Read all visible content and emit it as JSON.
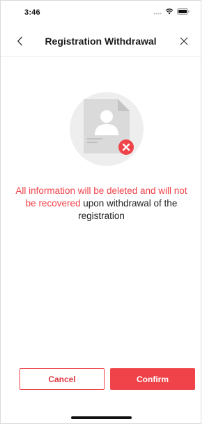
{
  "status_bar": {
    "time": "3:46",
    "icons": [
      "signal-icon",
      "wifi-icon",
      "battery-icon"
    ]
  },
  "nav": {
    "title": "Registration Withdrawal",
    "back_icon": "chevron-left-icon",
    "close_icon": "close-icon"
  },
  "illustration": {
    "icon": "document-user-delete-icon",
    "badge_color": "#ef4249"
  },
  "message": {
    "highlight": "All information will be deleted and will not be recovered",
    "rest": " upon withdrawal of the registration"
  },
  "buttons": {
    "cancel_label": "Cancel",
    "confirm_label": "Confirm"
  },
  "colors": {
    "accent": "#ef4249"
  }
}
